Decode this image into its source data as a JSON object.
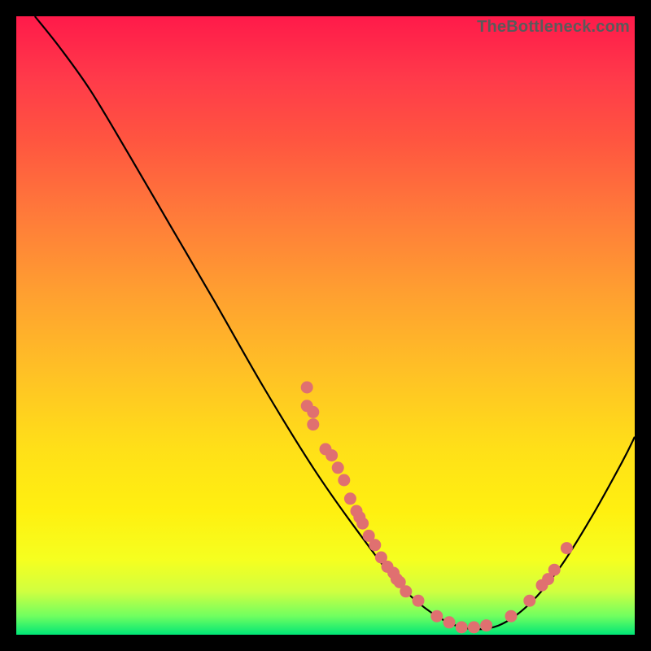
{
  "watermark": "TheBottleneck.com",
  "colors": {
    "curve_stroke": "#000000",
    "dot_fill": "#e07070",
    "dot_stroke": "#c85a5a"
  },
  "chart_data": {
    "type": "line",
    "title": "",
    "xlabel": "",
    "ylabel": "",
    "xlim": [
      0,
      100
    ],
    "ylim": [
      0,
      100
    ],
    "series": [
      {
        "name": "curve",
        "points": [
          {
            "x": 3,
            "y": 100
          },
          {
            "x": 7,
            "y": 95
          },
          {
            "x": 12,
            "y": 88
          },
          {
            "x": 18,
            "y": 78
          },
          {
            "x": 25,
            "y": 66
          },
          {
            "x": 32,
            "y": 54
          },
          {
            "x": 40,
            "y": 40
          },
          {
            "x": 48,
            "y": 27
          },
          {
            "x": 55,
            "y": 17
          },
          {
            "x": 62,
            "y": 8
          },
          {
            "x": 68,
            "y": 3
          },
          {
            "x": 73,
            "y": 1
          },
          {
            "x": 78,
            "y": 1.5
          },
          {
            "x": 83,
            "y": 5
          },
          {
            "x": 88,
            "y": 11
          },
          {
            "x": 93,
            "y": 19
          },
          {
            "x": 98,
            "y": 28
          },
          {
            "x": 100,
            "y": 32
          }
        ]
      }
    ],
    "scatter_points": [
      {
        "x": 47,
        "y": 40
      },
      {
        "x": 47,
        "y": 37
      },
      {
        "x": 48,
        "y": 36
      },
      {
        "x": 48,
        "y": 34
      },
      {
        "x": 50,
        "y": 30
      },
      {
        "x": 51,
        "y": 29
      },
      {
        "x": 52,
        "y": 27
      },
      {
        "x": 53,
        "y": 25
      },
      {
        "x": 54,
        "y": 22
      },
      {
        "x": 55,
        "y": 20
      },
      {
        "x": 55.5,
        "y": 19
      },
      {
        "x": 56,
        "y": 18
      },
      {
        "x": 57,
        "y": 16
      },
      {
        "x": 58,
        "y": 14.5
      },
      {
        "x": 59,
        "y": 12.5
      },
      {
        "x": 60,
        "y": 11
      },
      {
        "x": 61,
        "y": 10
      },
      {
        "x": 61.5,
        "y": 9
      },
      {
        "x": 62,
        "y": 8.5
      },
      {
        "x": 63,
        "y": 7
      },
      {
        "x": 65,
        "y": 5.5
      },
      {
        "x": 68,
        "y": 3
      },
      {
        "x": 70,
        "y": 2
      },
      {
        "x": 72,
        "y": 1.2
      },
      {
        "x": 74,
        "y": 1.2
      },
      {
        "x": 76,
        "y": 1.5
      },
      {
        "x": 80,
        "y": 3
      },
      {
        "x": 83,
        "y": 5.5
      },
      {
        "x": 85,
        "y": 8
      },
      {
        "x": 86,
        "y": 9
      },
      {
        "x": 87,
        "y": 10.5
      },
      {
        "x": 89,
        "y": 14
      }
    ]
  }
}
